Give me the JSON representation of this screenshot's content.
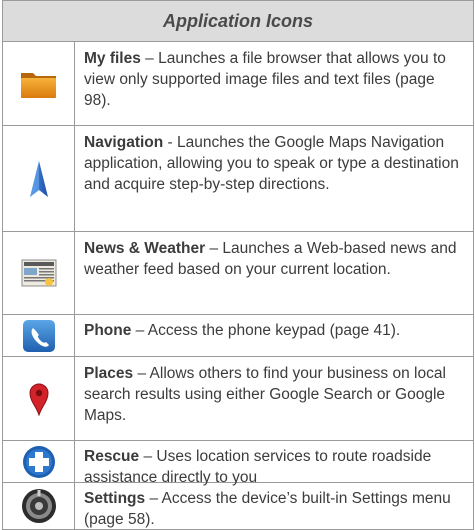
{
  "table": {
    "header": "Application Icons",
    "rows": [
      {
        "name": "My files",
        "sep": " – ",
        "desc": "Launches a file browser that allows you to view only supported image files and text files (page 98).",
        "icon": "folder-icon"
      },
      {
        "name": "Navigation",
        "sep": " - ",
        "desc": "Launches the Google Maps Navigation application, allowing you to speak or type a destination and acquire step-by-step directions.",
        "icon": "navigation-arrow-icon"
      },
      {
        "name": "News & Weather",
        "sep": " – ",
        "desc": "Launches a Web-based news and weather feed based on your current location.",
        "icon": "newspaper-icon"
      },
      {
        "name": "Phone",
        "sep": " – ",
        "desc": "Access the phone keypad (page 41).",
        "icon": "phone-icon"
      },
      {
        "name": "Places",
        "sep": " – ",
        "desc": "Allows others to find your business on local search results using either Google Search or Google Maps.",
        "icon": "map-pin-icon"
      },
      {
        "name": "Rescue",
        "sep": " – ",
        "desc": "Uses location services to route roadside assistance directly to you",
        "icon": "rescue-cross-icon"
      },
      {
        "name": "Settings",
        "sep": " – ",
        "desc": "Access the device’s built-in Settings menu (page 58).",
        "icon": "settings-knob-icon"
      }
    ]
  }
}
